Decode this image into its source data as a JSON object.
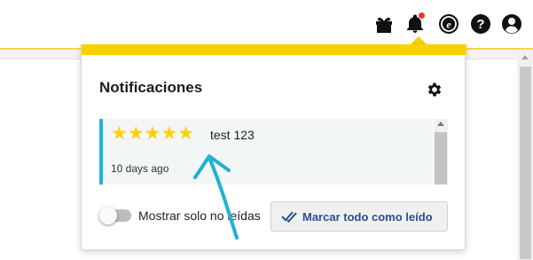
{
  "header": {
    "icons": [
      "gift-icon",
      "bell-icon",
      "evernote-icon",
      "help-icon",
      "account-icon"
    ],
    "bell_has_unread": true
  },
  "notifications_popup": {
    "title": "Notificaciones",
    "items": [
      {
        "rating": 5,
        "stars": "★★★★★",
        "text": "test 123",
        "time": "10 days ago"
      }
    ],
    "unread_only_label": "Mostrar solo no leídas",
    "unread_only_enabled": false,
    "mark_all_label": "Marcar todo como leído"
  },
  "colors": {
    "accent_yellow": "#f7d200",
    "item_border": "#1fb3d8",
    "star": "#ffd000",
    "button_text": "#2b4f8f",
    "annotation_arrow": "#22b0d3"
  }
}
